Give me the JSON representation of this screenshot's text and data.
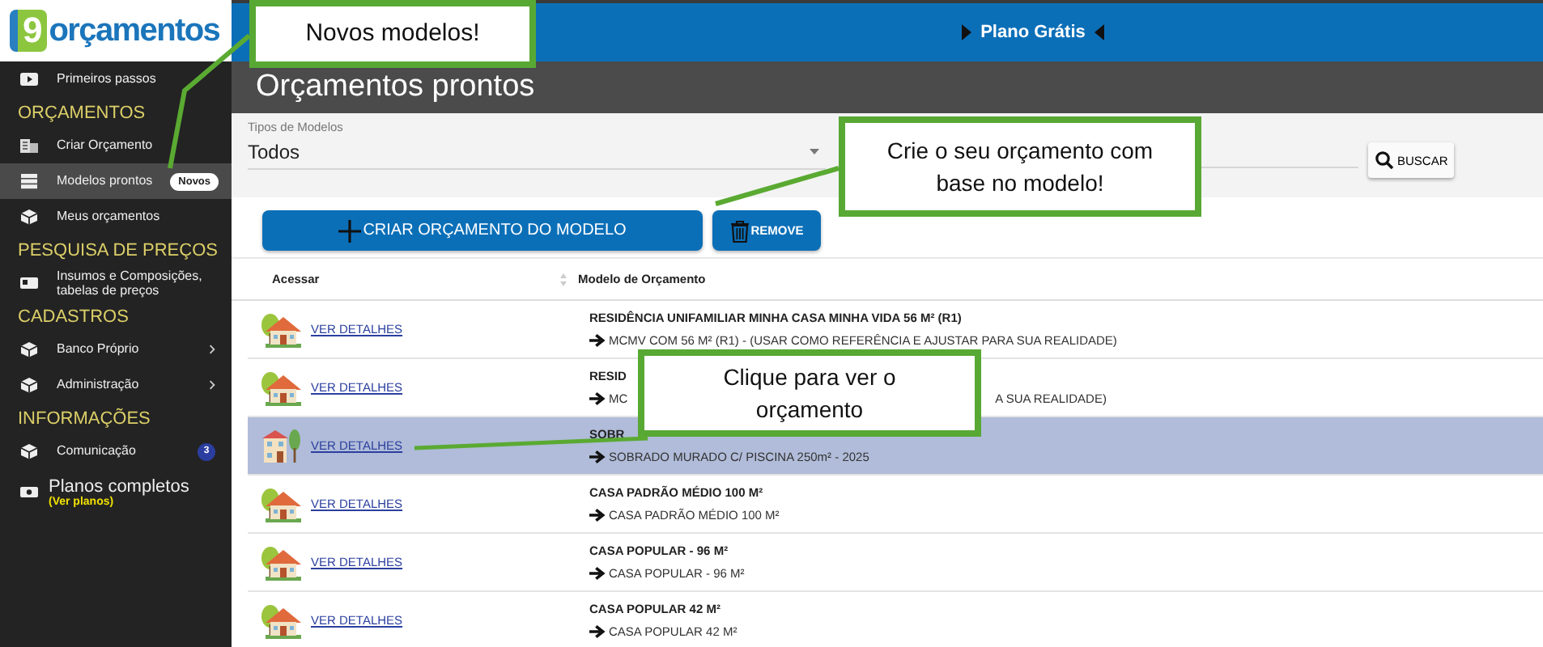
{
  "logo": {
    "text": "orçamentos",
    "mark": "9"
  },
  "sidebar": {
    "items": [
      {
        "kind": "item",
        "label": "Primeiros passos",
        "selected": false
      },
      {
        "kind": "heading",
        "label": "ORÇAMENTOS"
      },
      {
        "kind": "item",
        "label": "Criar Orçamento",
        "selected": false
      },
      {
        "kind": "item",
        "label": "Modelos prontos",
        "selected": true,
        "badge": "Novos"
      },
      {
        "kind": "item",
        "label": "Meus orçamentos",
        "selected": false
      },
      {
        "kind": "heading",
        "label": "PESQUISA DE PREÇOS"
      },
      {
        "kind": "item",
        "label": "Insumos e Composições, tabelas de preços",
        "selected": false
      },
      {
        "kind": "heading",
        "label": "CADASTROS"
      },
      {
        "kind": "item",
        "label": "Banco Próprio",
        "selected": false,
        "submenu": true
      },
      {
        "kind": "item",
        "label": "Administração",
        "selected": false,
        "submenu": true
      },
      {
        "kind": "heading",
        "label": "INFORMAÇÕES"
      },
      {
        "kind": "item",
        "label": "Comunicação",
        "selected": false,
        "count": "3"
      },
      {
        "kind": "plan",
        "label": "Planos completos",
        "link": "(Ver planos)",
        "selected": false
      }
    ]
  },
  "top_bar": {
    "plan": "Plano Grátis"
  },
  "page_title": "Orçamentos prontos",
  "filter": {
    "label": "Tipos de Modelos",
    "value": "Todos",
    "search_button": "BUSCAR"
  },
  "buttons": {
    "create": "CRIAR ORÇAMENTO DO MODELO",
    "remove": "REMOVE"
  },
  "table": {
    "columns": [
      "Acessar",
      "Modelo de Orçamento"
    ],
    "rows": [
      {
        "kind": "house",
        "link": "VER DETALHES",
        "title": "RESIDÊNCIA UNIFAMILIAR MINHA CASA MINHA VIDA 56 M² (R1)",
        "subtitle": [
          "MCMV COM 56 M² (R1) - (USAR COMO REFERÊNCIA E AJUSTAR PARA SUA REALIDADE)"
        ],
        "selected": false
      },
      {
        "kind": "house",
        "link": "VER DETALHES",
        "title": "RESID",
        "subtitle": [
          "MC",
          "A SUA REALIDADE)"
        ],
        "selected": false
      },
      {
        "kind": "townhouse",
        "link": "VER DETALHES",
        "title": "SOBR",
        "subtitle": [
          "SOBRADO MURADO C/ PISCINA 250m² - 2025"
        ],
        "selected": true
      },
      {
        "kind": "house",
        "link": "VER DETALHES",
        "title": "CASA PADRÃO MÉDIO 100 M²",
        "subtitle": [
          "CASA PADRÃO MÉDIO 100 M²"
        ],
        "selected": false
      },
      {
        "kind": "house",
        "link": "VER DETALHES",
        "title": "CASA POPULAR - 96 M²",
        "subtitle": [
          "CASA POPULAR - 96 M²"
        ],
        "selected": false
      },
      {
        "kind": "house",
        "link": "VER DETALHES",
        "title": "CASA POPULAR 42 M²",
        "subtitle": [
          "CASA POPULAR 42 M²"
        ],
        "selected": false
      }
    ]
  },
  "callouts": [
    {
      "text": "Novos modelos!"
    },
    {
      "text": "Crie o seu orçamento com base no modelo!"
    },
    {
      "text": "Clique para ver o orçamento"
    }
  ]
}
